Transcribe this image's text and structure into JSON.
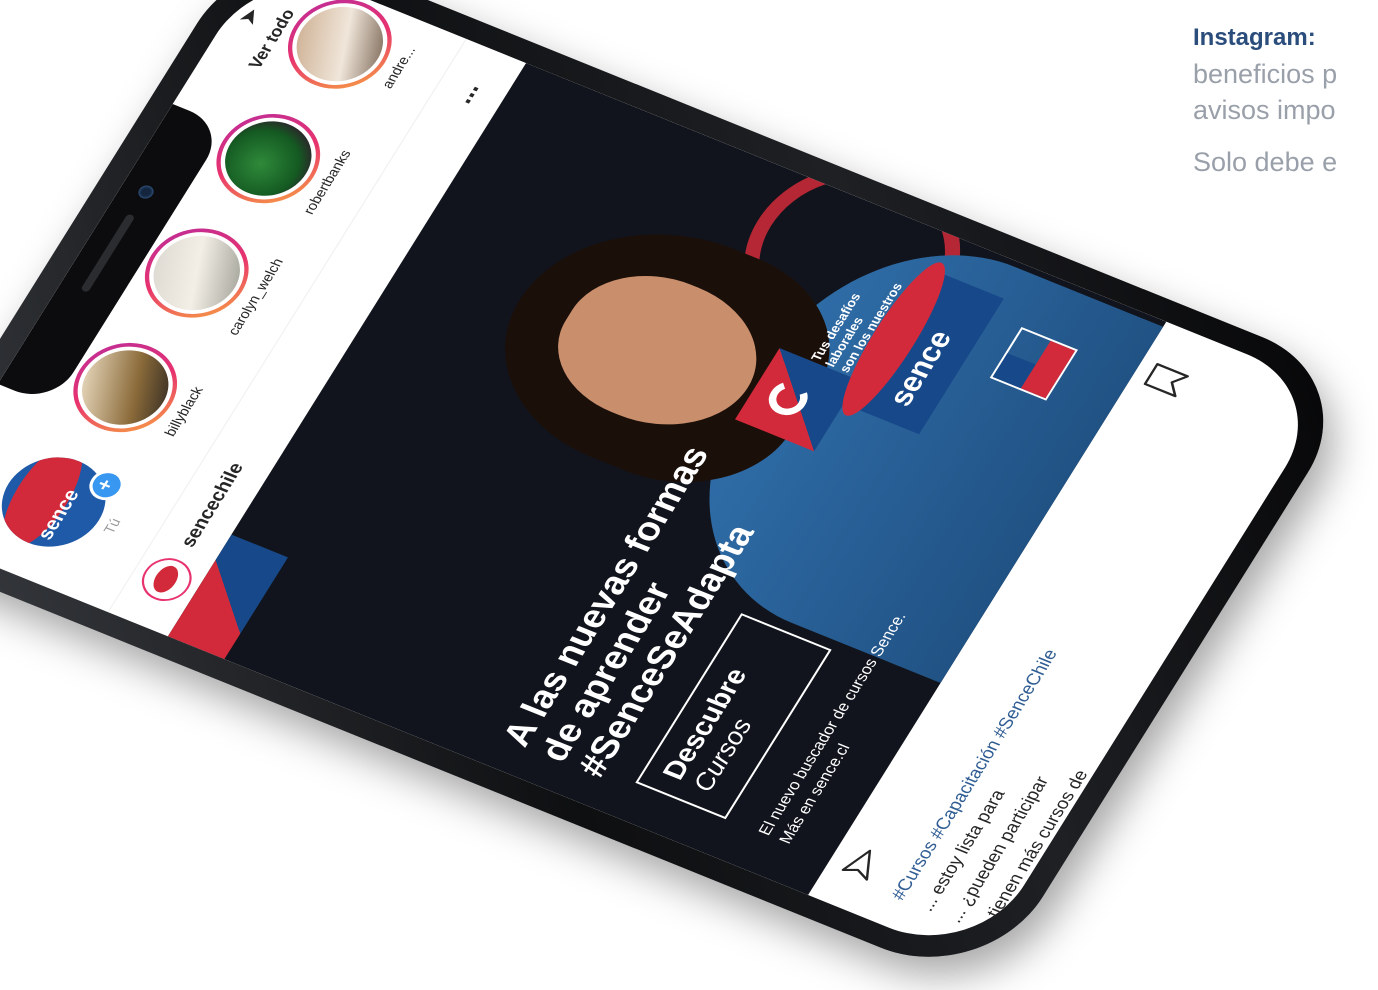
{
  "side": {
    "title": "Instagram:",
    "line1": "beneficios p",
    "line2": "avisos impo",
    "line3": "Solo debe e"
  },
  "stories": {
    "see_all": "Ver todo",
    "items": [
      {
        "label": "Tú",
        "own_word": "sence",
        "plus": "+"
      },
      {
        "label": "billyblack"
      },
      {
        "label": "carolyn_welch"
      },
      {
        "label": "robertbanks"
      },
      {
        "label": "andre..."
      }
    ]
  },
  "post": {
    "username": "sencechile",
    "more": "...",
    "headline": [
      "A las nuevas formas",
      "de aprender",
      "#SenceSeAdapta"
    ],
    "cta_line1": "Descubre",
    "cta_line2": "Cursos",
    "subline1": "El nuevo buscador de cursos Sence.",
    "subline2": "Más en sence.cl",
    "brand_word": "sence",
    "tagline": [
      "Tus desafíos",
      "laborales",
      "son los nuestros"
    ]
  },
  "caption": {
    "tags": "#Cursos #Capacitación #SenceChile",
    "line1": "... estoy lista para",
    "line2": "... ¿pueden participar",
    "line3": "... tienen más cursos de"
  },
  "colors": {
    "sence_red": "#d22a3a",
    "sence_blue": "#17498a",
    "instagram_story_ring": "#e8336e",
    "link_blue": "#2f5d93"
  }
}
